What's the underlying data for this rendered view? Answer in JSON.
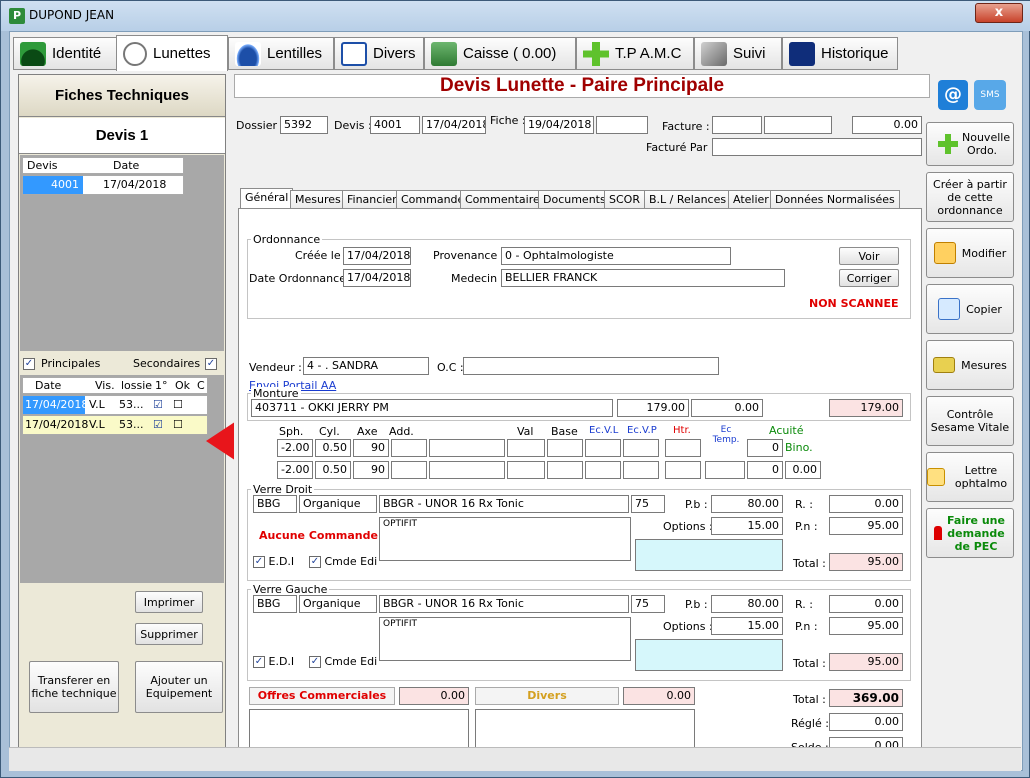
{
  "window": {
    "title": "DUPOND JEAN",
    "close_label": "x"
  },
  "main_tabs": [
    {
      "label": "Identité"
    },
    {
      "label": "Lunettes"
    },
    {
      "label": "Lentilles"
    },
    {
      "label": "Divers"
    },
    {
      "label": "Caisse ( 0.00)"
    },
    {
      "label": "T.P A.M.C"
    },
    {
      "label": "Suivi"
    },
    {
      "label": "Historique"
    }
  ],
  "left": {
    "title": "Fiches Techniques",
    "subtitle": "Devis 1",
    "devis_headers": [
      "Devis",
      "Date"
    ],
    "devis_rows": [
      {
        "devis": "4001",
        "date": "17/04/2018"
      }
    ],
    "principales_label": "Principales",
    "secondaires_label": "Secondaires",
    "fiche_headers": [
      "Date",
      "Vis.",
      "lossie",
      "1°",
      "Ok",
      "C"
    ],
    "fiche_rows": [
      {
        "date": "17/04/2018",
        "vis": "V.L",
        "dossier": "53...",
        "first": "☑",
        "ok": "☐"
      },
      {
        "date": "17/04/2018",
        "vis": "V.L",
        "dossier": "53...",
        "first": "☑",
        "ok": "☐"
      }
    ],
    "imprimer": "Imprimer",
    "supprimer": "Supprimer",
    "transferer": "Transferer en fiche technique",
    "ajouter": "Ajouter un Equipement"
  },
  "header": {
    "title": "Devis Lunette - Paire Principale",
    "dossier_label": "Dossier :",
    "dossier": "5392",
    "devis_label": "Devis :",
    "devis": "4001",
    "devis_date": "17/04/2018",
    "fiche_label": "Fiche :",
    "fiche_date": "19/04/2018",
    "facture_label": "Facture :",
    "facture_amount": "0.00",
    "facture_par_label": "Facturé Par :"
  },
  "subtabs": [
    "Général",
    "Mesures",
    "Financier",
    "Commande",
    "Commentaires",
    "Documents",
    "SCOR",
    "B.L / Relances",
    "Atelier",
    "Données Normalisées"
  ],
  "ordonnance": {
    "group_title": "Ordonnance",
    "creee_label": "Créée le :",
    "creee": "17/04/2018",
    "provenance_label": "Provenance :",
    "provenance": "0 - Ophtalmologiste",
    "date_ord_label": "Date Ordonnance :",
    "date_ord": "17/04/2018",
    "medecin_label": "Medecin :",
    "medecin": "BELLIER FRANCK",
    "voir": "Voir",
    "corriger": "Corriger",
    "status": "NON SCANNEE"
  },
  "vendeur": {
    "label": "Vendeur :",
    "value": "4 - . SANDRA",
    "oc_label": "O.C :",
    "envoi_portail": "Envoi Portail AA"
  },
  "monture": {
    "group_title": "Monture",
    "ref": "403711 - OKKI JERRY PM",
    "price": "179.00",
    "remise": "0.00",
    "total": "179.00"
  },
  "refraction": {
    "headers": {
      "sph": "Sph.",
      "cyl": "Cyl.",
      "axe": "Axe",
      "add": "Add.",
      "val": "Val",
      "base": "Base",
      "ecvl": "Ec.V.L",
      "ecvp": "Ec.V.P",
      "htr": "Htr.",
      "ectemp": "Ec Temp.",
      "acuite": "Acuité",
      "bino": "Bino."
    },
    "od": {
      "sph": "-2.00",
      "cyl": "0.50",
      "axe": "90",
      "acuite": "0"
    },
    "og": {
      "sph": "-2.00",
      "cyl": "0.50",
      "axe": "90",
      "acuite": "0",
      "bino": "0.00"
    }
  },
  "verre_droit": {
    "group_title": "Verre Droit",
    "code": "BBG",
    "matiere": "Organique",
    "designation": "BBGR - UNOR 16 Rx Tonic",
    "diam": "75",
    "pb_label": "P.b :",
    "pb": "80.00",
    "r_label": "R. :",
    "r": "0.00",
    "options_label": "Options :",
    "options": "15.00",
    "pn_label": "P.n :",
    "pn": "95.00",
    "traitement": "OPTIFIT",
    "commande_status": "Aucune Commande",
    "edi": "E.D.I",
    "cmde_edi": "Cmde Edi",
    "total_label": "Total :",
    "total": "95.00"
  },
  "verre_gauche": {
    "group_title": "Verre Gauche",
    "code": "BBG",
    "matiere": "Organique",
    "designation": "BBGR - UNOR 16 Rx Tonic",
    "diam": "75",
    "pb_label": "P.b :",
    "pb": "80.00",
    "r_label": "R. :",
    "r": "0.00",
    "options_label": "Options :",
    "options": "15.00",
    "pn_label": "P.n :",
    "pn": "95.00",
    "traitement": "OPTIFIT",
    "edi": "E.D.I",
    "cmde_edi": "Cmde Edi",
    "total_label": "Total :",
    "total": "95.00"
  },
  "totaux": {
    "offres_label": "Offres Commerciales",
    "offres": "0.00",
    "divers_label": "Divers",
    "divers": "0.00",
    "total_label": "Total :",
    "total": "369.00",
    "regle_label": "Réglé :",
    "regle": "0.00",
    "solde_label": "Solde :",
    "solde": "0.00"
  },
  "right_buttons": {
    "nouvelle_ordo": "Nouvelle Ordo.",
    "creer": "Créer à partir de cette ordonnance",
    "modifier": "Modifier",
    "copier": "Copier",
    "mesures": "Mesures",
    "sesame": "Contrôle Sesame Vitale",
    "lettre": "Lettre ophtalmo",
    "pec": "Faire une demande de PEC"
  },
  "colors": {
    "title_red": "#a00000",
    "alert_red": "#e00000",
    "selection": "#3399ff",
    "pink_field": "#fbe3e3",
    "cyan_field": "#d6f7fb",
    "arrow_red": "#e8151b"
  }
}
